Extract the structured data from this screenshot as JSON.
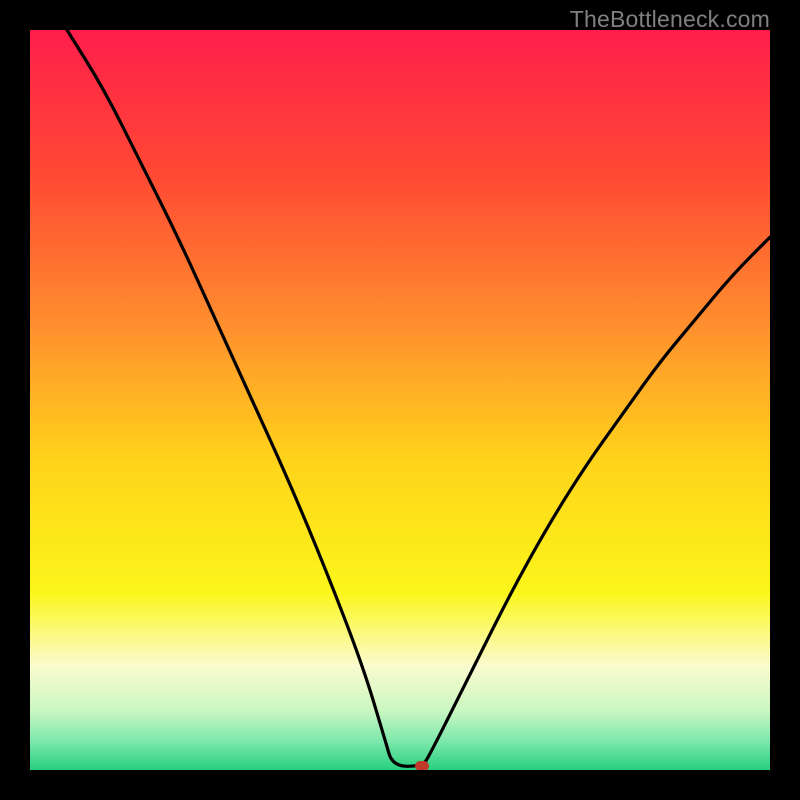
{
  "watermark": "TheBottleneck.com",
  "chart_data": {
    "type": "line",
    "title": "",
    "xlabel": "",
    "ylabel": "",
    "xlim": [
      0,
      100
    ],
    "ylim": [
      0,
      100
    ],
    "grid": false,
    "legend": false,
    "marker": {
      "x": 53,
      "y": 0,
      "color": "#c0392b"
    },
    "curve_points": [
      {
        "x": 5,
        "y": 100
      },
      {
        "x": 10,
        "y": 92
      },
      {
        "x": 15,
        "y": 82
      },
      {
        "x": 20,
        "y": 72
      },
      {
        "x": 25,
        "y": 61
      },
      {
        "x": 30,
        "y": 50
      },
      {
        "x": 35,
        "y": 39
      },
      {
        "x": 40,
        "y": 27
      },
      {
        "x": 45,
        "y": 14
      },
      {
        "x": 48,
        "y": 4
      },
      {
        "x": 49,
        "y": 0.5
      },
      {
        "x": 53,
        "y": 0.5
      },
      {
        "x": 54,
        "y": 2
      },
      {
        "x": 60,
        "y": 14
      },
      {
        "x": 65,
        "y": 24
      },
      {
        "x": 70,
        "y": 33
      },
      {
        "x": 75,
        "y": 41
      },
      {
        "x": 80,
        "y": 48
      },
      {
        "x": 85,
        "y": 55
      },
      {
        "x": 90,
        "y": 61
      },
      {
        "x": 95,
        "y": 67
      },
      {
        "x": 100,
        "y": 72
      }
    ],
    "gradient_stops": [
      {
        "pct": 0,
        "color": "#ff1e4b"
      },
      {
        "pct": 20,
        "color": "#ff4a33"
      },
      {
        "pct": 40,
        "color": "#ff8f2e"
      },
      {
        "pct": 58,
        "color": "#ffd31a"
      },
      {
        "pct": 76,
        "color": "#fbf61a"
      },
      {
        "pct": 86,
        "color": "#fbfbd0"
      },
      {
        "pct": 92,
        "color": "#c9f7c0"
      },
      {
        "pct": 96,
        "color": "#7fe8ad"
      },
      {
        "pct": 100,
        "color": "#26d07c"
      }
    ]
  }
}
